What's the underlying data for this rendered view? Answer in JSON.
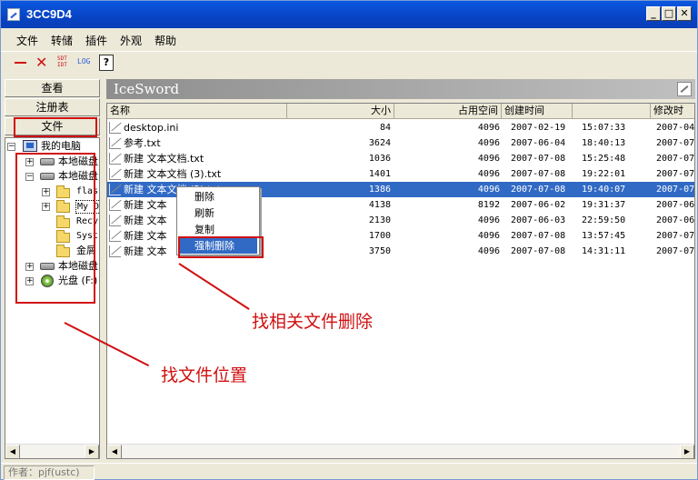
{
  "window": {
    "title": "3CC9D4",
    "minimize": "_",
    "maximize": "□",
    "close": "✕"
  },
  "menu": [
    "文件",
    "转储",
    "插件",
    "外观",
    "帮助"
  ],
  "toolbar": {
    "icons": [
      "minus-icon",
      "delete-x-icon",
      "sdt-idt-icon",
      "log-icon",
      "help-icon"
    ],
    "sdt_top": "SDT",
    "sdt_bottom": "IDT",
    "log": "LOG",
    "help": "?"
  },
  "left_tabs": [
    "查看",
    "注册表",
    "文件"
  ],
  "tree": {
    "root": "我的电脑",
    "nodes": [
      {
        "label": "本地磁盘",
        "type": "drive",
        "expander": "+"
      },
      {
        "label": "本地磁盘",
        "type": "drive",
        "expander": "−"
      },
      {
        "label": "flas",
        "type": "folder",
        "expander": "+"
      },
      {
        "label": "My D",
        "type": "folder",
        "expander": "+"
      },
      {
        "label": "Recy",
        "type": "folder",
        "expander": ""
      },
      {
        "label": "Syst",
        "type": "folder",
        "expander": ""
      },
      {
        "label": "金屑",
        "type": "folder",
        "expander": ""
      },
      {
        "label": "本地磁盘",
        "type": "drive",
        "expander": "+"
      },
      {
        "label": "光盘 (F:)",
        "type": "cd",
        "expander": "+"
      }
    ]
  },
  "panel_title": "IceSword",
  "columns": [
    "名称",
    "大小",
    "占用空间",
    "创建时间",
    "",
    "修改时"
  ],
  "files": [
    {
      "name": "desktop.ini",
      "size": "84",
      "alloc": "4096",
      "date": "2007-02-19",
      "time": "15:07:33",
      "mod": "2007-04"
    },
    {
      "name": "参考.txt",
      "size": "3624",
      "alloc": "4096",
      "date": "2007-06-04",
      "time": "18:40:13",
      "mod": "2007-07"
    },
    {
      "name": "新建 文本文档.txt",
      "size": "1036",
      "alloc": "4096",
      "date": "2007-07-08",
      "time": "15:25:48",
      "mod": "2007-07"
    },
    {
      "name": "新建 文本文档 (3).txt",
      "size": "1401",
      "alloc": "4096",
      "date": "2007-07-08",
      "time": "19:22:01",
      "mod": "2007-07"
    },
    {
      "name": "新建 文本文档 (2).txt",
      "size": "1386",
      "alloc": "4096",
      "date": "2007-07-08",
      "time": "19:40:07",
      "mod": "2007-07",
      "selected": true
    },
    {
      "name": "新建 文本",
      "size": "4138",
      "alloc": "8192",
      "date": "2007-06-02",
      "time": "19:31:37",
      "mod": "2007-06"
    },
    {
      "name": "新建 文本",
      "size": "2130",
      "alloc": "4096",
      "date": "2007-06-03",
      "time": "22:59:50",
      "mod": "2007-06"
    },
    {
      "name": "新建 文本",
      "size": "1700",
      "alloc": "4096",
      "date": "2007-07-08",
      "time": "13:57:45",
      "mod": "2007-07"
    },
    {
      "name": "新建 文本",
      "size": "3750",
      "alloc": "4096",
      "date": "2007-07-08",
      "time": "14:31:11",
      "mod": "2007-07"
    }
  ],
  "context_menu": [
    "删除",
    "刷新",
    "复制",
    "强制删除"
  ],
  "annotations": {
    "find_delete": "找相关文件删除",
    "find_location": "找文件位置"
  },
  "status": "作者：pjf(ustc)",
  "colors": {
    "selection": "#316ac5",
    "annotation": "#d01010",
    "titlebar": "#0a58e0"
  }
}
